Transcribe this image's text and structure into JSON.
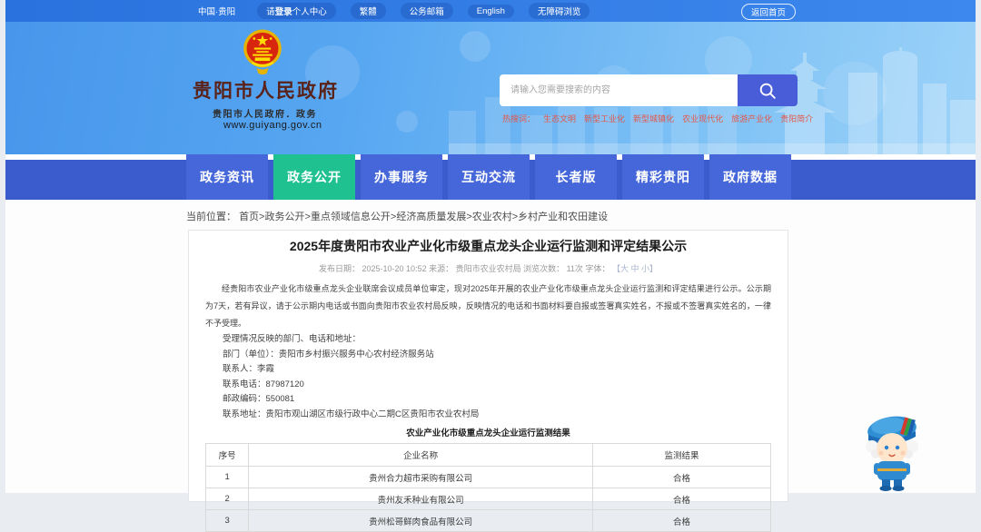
{
  "topbar": {
    "region": "中国·贵阳",
    "login_prefix": "请",
    "login_bold": "登录",
    "login_suffix": "个人中心",
    "pills": [
      "繁體",
      "公务邮箱",
      "English",
      "无障碍浏览"
    ],
    "home_button": "返回首页"
  },
  "header": {
    "site_title": "贵阳市人民政府",
    "site_subtitle": "贵阳市人民政府．政务",
    "site_url": "www.guiyang.gov.cn",
    "search_placeholder": "请输入您需要搜索的内容",
    "hot_label": "热搜词：",
    "hot_words": [
      "生态文明",
      "新型工业化",
      "新型城镇化",
      "农业现代化",
      "旅游产业化",
      "贵阳简介"
    ]
  },
  "nav": {
    "items": [
      {
        "label": "政务资讯",
        "active": false
      },
      {
        "label": "政务公开",
        "active": true
      },
      {
        "label": "办事服务",
        "active": false
      },
      {
        "label": "互动交流",
        "active": false
      },
      {
        "label": "长者版",
        "active": false
      },
      {
        "label": "精彩贵阳",
        "active": false
      },
      {
        "label": "政府数据",
        "active": false
      }
    ]
  },
  "breadcrumb": {
    "label": "当前位置：",
    "path": "首页>政务公开>重点领域信息公开>经济高质量发展>农业农村>乡村产业和农田建设"
  },
  "article": {
    "title": "2025年度贵阳市农业产业化市级重点龙头企业运行监测和评定结果公示",
    "meta_text": "发布日期： 2025-10-20 10:52 来源： 贵阳市农业农村局 浏览次数： 11次 字体：",
    "meta_font_selector": "【大 中 小】",
    "paragraph": "经贵阳市农业产业化市级重点龙头企业联席会议成员单位审定，现对2025年开展的农业产业化市级重点龙头企业运行监测和评定结果进行公示。公示期为7天，若有异议，请于公示期内电话或书面向贵阳市农业农村局反映，反映情况的电话和书面材料要自报或签署真实姓名，不报或不签署真实姓名的，一律不予受理。",
    "contact_lines": [
      "受理情况反映的部门、电话和地址：",
      "部门（单位）：贵阳市乡村振兴服务中心农村经济服务站",
      "联系人：李霞",
      "联系电话：87987120",
      "邮政编码：550081",
      "联系地址：贵阳市观山湖区市级行政中心二期C区贵阳市农业农村局"
    ],
    "table": {
      "title": "农业产业化市级重点龙头企业运行监测结果",
      "headers": [
        "序号",
        "企业名称",
        "监测结果"
      ],
      "rows": [
        [
          "1",
          "贵州合力超市采购有限公司",
          "合格"
        ],
        [
          "2",
          "贵州友禾种业有限公司",
          "合格"
        ],
        [
          "3",
          "贵州松哥鲜肉食品有限公司",
          "合格"
        ]
      ]
    }
  },
  "colors": {
    "topbar_blue": "#2e7ce2",
    "banner_blue": "#56a6f1",
    "nav_blue": "#3a5ccd",
    "nav_tab_blue": "#4667d9",
    "nav_active_green": "#1ec18f",
    "search_button_indigo": "#4a5dd8",
    "hot_word_red": "#e4574a",
    "title_maroon": "#5a2218",
    "emblem_red": "#d8250e",
    "emblem_gold": "#ffde00"
  }
}
